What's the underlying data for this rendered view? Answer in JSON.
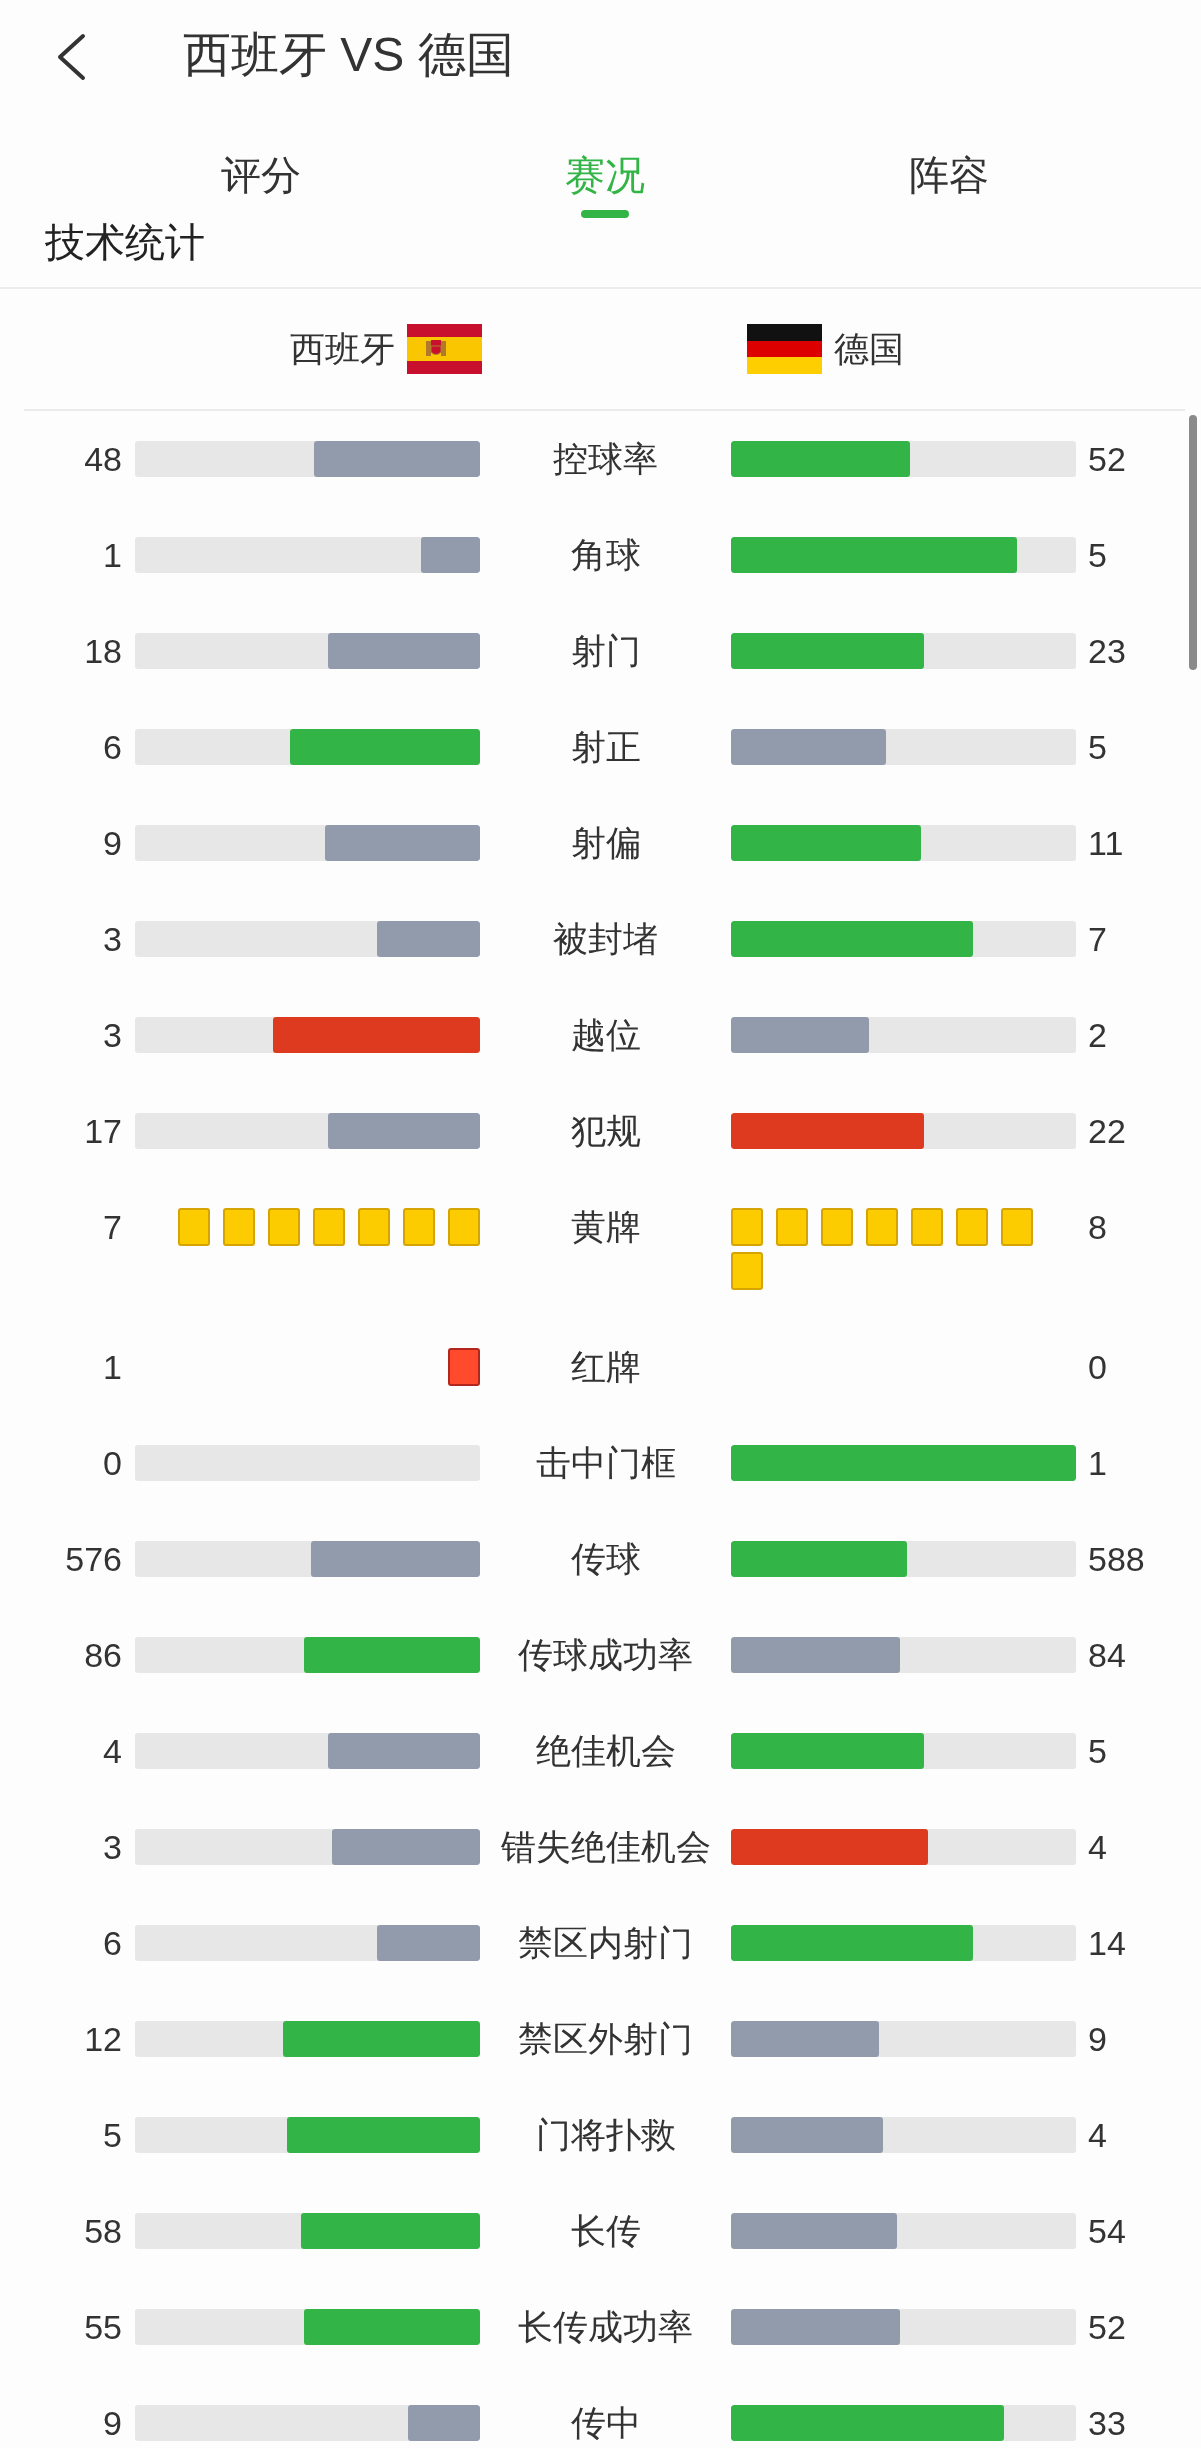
{
  "header": {
    "title": "西班牙 VS 德国"
  },
  "tabs": [
    {
      "label": "评分",
      "selected": false
    },
    {
      "label": "赛况",
      "selected": true
    },
    {
      "label": "阵容",
      "selected": false
    }
  ],
  "section_title": "技术统计",
  "teams": {
    "home": {
      "name": "西班牙"
    },
    "away": {
      "name": "德国"
    }
  },
  "stats": [
    {
      "kind": "bar",
      "label": "控球率",
      "home": {
        "value": "48",
        "level": 0.48,
        "color": "#929bab"
      },
      "away": {
        "value": "52",
        "level": 0.52,
        "color": "#32b546"
      }
    },
    {
      "kind": "bar",
      "label": "角球",
      "home": {
        "value": "1",
        "level": 0.17,
        "color": "#929bab"
      },
      "away": {
        "value": "5",
        "level": 0.83,
        "color": "#32b546"
      }
    },
    {
      "kind": "bar",
      "label": "射门",
      "home": {
        "value": "18",
        "level": 0.44,
        "color": "#929bab"
      },
      "away": {
        "value": "23",
        "level": 0.56,
        "color": "#32b546"
      }
    },
    {
      "kind": "bar",
      "label": "射正",
      "home": {
        "value": "6",
        "level": 0.55,
        "color": "#32b546"
      },
      "away": {
        "value": "5",
        "level": 0.45,
        "color": "#929bab"
      }
    },
    {
      "kind": "bar",
      "label": "射偏",
      "home": {
        "value": "9",
        "level": 0.45,
        "color": "#929bab"
      },
      "away": {
        "value": "11",
        "level": 0.55,
        "color": "#32b546"
      }
    },
    {
      "kind": "bar",
      "label": "被封堵",
      "home": {
        "value": "3",
        "level": 0.3,
        "color": "#929bab"
      },
      "away": {
        "value": "7",
        "level": 0.7,
        "color": "#32b546"
      }
    },
    {
      "kind": "bar",
      "label": "越位",
      "home": {
        "value": "3",
        "level": 0.6,
        "color": "#de3a1f"
      },
      "away": {
        "value": "2",
        "level": 0.4,
        "color": "#929bab"
      }
    },
    {
      "kind": "bar",
      "label": "犯规",
      "home": {
        "value": "17",
        "level": 0.44,
        "color": "#929bab"
      },
      "away": {
        "value": "22",
        "level": 0.56,
        "color": "#de3a1f"
      }
    },
    {
      "kind": "yellow_cards",
      "label": "黄牌",
      "home": {
        "value": "7"
      },
      "away": {
        "value": "8"
      }
    },
    {
      "kind": "red_cards",
      "label": "红牌",
      "home": {
        "value": "1"
      },
      "away": {
        "value": "0"
      }
    },
    {
      "kind": "bar",
      "label": "击中门框",
      "home": {
        "value": "0"
      },
      "away": {
        "value": "1",
        "level": 1,
        "color": "#32b546"
      }
    },
    {
      "kind": "bar",
      "label": "传球",
      "home": {
        "value": "576",
        "level": 0.49,
        "color": "#929bab"
      },
      "away": {
        "value": "588",
        "level": 0.51,
        "color": "#32b546"
      }
    },
    {
      "kind": "bar",
      "label": "传球成功率",
      "home": {
        "value": "86",
        "level": 0.51,
        "color": "#32b546"
      },
      "away": {
        "value": "84",
        "level": 0.49,
        "color": "#929bab"
      }
    },
    {
      "kind": "bar",
      "label": "绝佳机会",
      "home": {
        "value": "4",
        "level": 0.44,
        "color": "#929bab"
      },
      "away": {
        "value": "5",
        "level": 0.56,
        "color": "#32b546"
      }
    },
    {
      "kind": "bar",
      "label": "错失绝佳机会",
      "home": {
        "value": "3",
        "level": 0.43,
        "color": "#929bab"
      },
      "away": {
        "value": "4",
        "level": 0.57,
        "color": "#de3a1f"
      }
    },
    {
      "kind": "bar",
      "label": "禁区内射门",
      "home": {
        "value": "6",
        "level": 0.3,
        "color": "#929bab"
      },
      "away": {
        "value": "14",
        "level": 0.7,
        "color": "#32b546"
      }
    },
    {
      "kind": "bar",
      "label": "禁区外射门",
      "home": {
        "value": "12",
        "level": 0.57,
        "color": "#32b546"
      },
      "away": {
        "value": "9",
        "level": 0.43,
        "color": "#929bab"
      }
    },
    {
      "kind": "bar",
      "label": "门将扑救",
      "home": {
        "value": "5",
        "level": 0.56,
        "color": "#32b546"
      },
      "away": {
        "value": "4",
        "level": 0.44,
        "color": "#929bab"
      }
    },
    {
      "kind": "bar",
      "label": "长传",
      "home": {
        "value": "58",
        "level": 0.52,
        "color": "#32b546"
      },
      "away": {
        "value": "54",
        "level": 0.48,
        "color": "#929bab"
      }
    },
    {
      "kind": "bar",
      "label": "长传成功率",
      "home": {
        "value": "55",
        "level": 0.51,
        "color": "#32b546"
      },
      "away": {
        "value": "52",
        "level": 0.49,
        "color": "#929bab"
      }
    },
    {
      "kind": "bar",
      "label": "传中",
      "home": {
        "value": "9",
        "level": 0.21,
        "color": "#929bab"
      },
      "away": {
        "value": "33",
        "level": 0.79,
        "color": "#32b546"
      }
    }
  ]
}
